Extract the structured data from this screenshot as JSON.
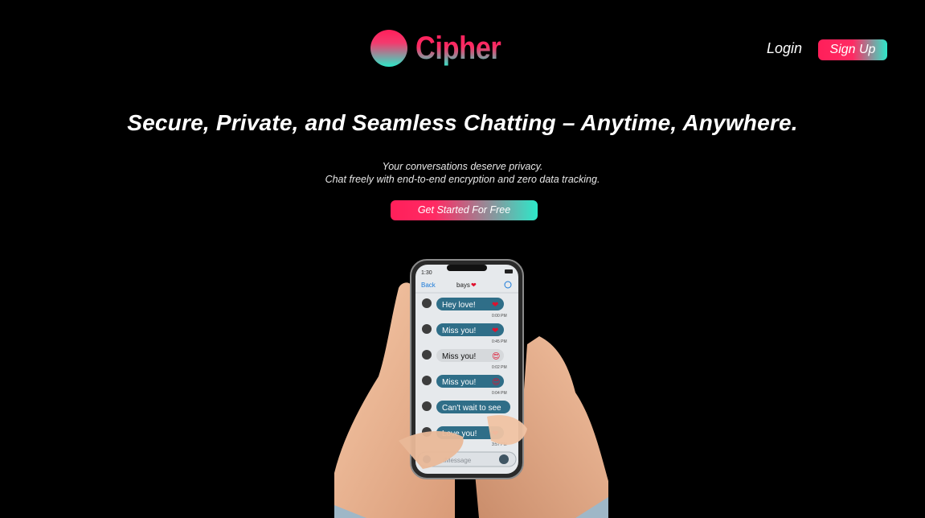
{
  "brand": {
    "name": "Cipher",
    "logo_icon": "circle-gradient-icon"
  },
  "nav": {
    "login_label": "Login",
    "signup_label": "Sign Up"
  },
  "hero": {
    "headline": "Secure, Private, and Seamless Chatting – Anytime, Anywhere.",
    "subtext_line1": "Your conversations deserve privacy.",
    "subtext_line2": "Chat freely with end-to-end encryption and zero data tracking.",
    "cta_label": "Get Started For Free"
  },
  "phone_image": {
    "status_time": "1:30",
    "chat_title": "bays",
    "back_label": "Back",
    "messages": [
      {
        "text": "Hey love!",
        "emoji": "❤",
        "time": "0:00 PM"
      },
      {
        "text": "Miss you!",
        "emoji": "❤",
        "time": "0:45 PM"
      },
      {
        "text": "Miss you!",
        "emoji": "😍",
        "time": "0:02 PM"
      },
      {
        "text": "Miss you!",
        "emoji": "😍",
        "time": "0:04 PM"
      },
      {
        "text": "Can't wait to see",
        "emoji": "",
        "time": ""
      },
      {
        "text": "Love you!",
        "emoji": "❤",
        "time": "3:57 PM"
      }
    ],
    "input_placeholder": "iMessage"
  },
  "colors": {
    "accent_pink": "#ff1f5a",
    "accent_teal": "#2de8c9",
    "background": "#000000"
  }
}
